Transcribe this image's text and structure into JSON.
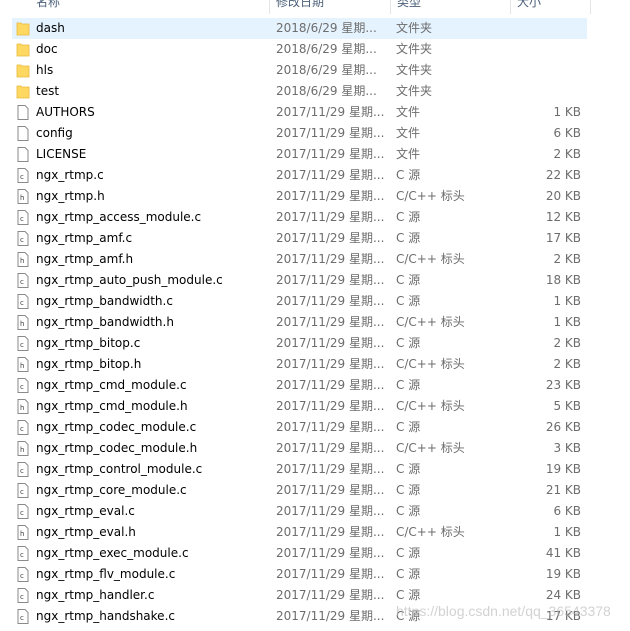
{
  "header": {
    "columns": [
      "名称",
      "修改日期",
      "类型",
      "大小"
    ]
  },
  "colors": {
    "selected_row": "#e5f3ff",
    "folder": "#ffd862"
  },
  "files": [
    {
      "name": "dash",
      "date": "2018/6/29 星期...",
      "type": "文件夹",
      "size": "",
      "icon": "folder-icon",
      "selected": true
    },
    {
      "name": "doc",
      "date": "2018/6/29 星期...",
      "type": "文件夹",
      "size": "",
      "icon": "folder-icon"
    },
    {
      "name": "hls",
      "date": "2018/6/29 星期...",
      "type": "文件夹",
      "size": "",
      "icon": "folder-icon"
    },
    {
      "name": "test",
      "date": "2018/6/29 星期...",
      "type": "文件夹",
      "size": "",
      "icon": "folder-icon"
    },
    {
      "name": "AUTHORS",
      "date": "2017/11/29 星期...",
      "type": "文件",
      "size": "1 KB",
      "icon": "file-icon"
    },
    {
      "name": "config",
      "date": "2017/11/29 星期...",
      "type": "文件",
      "size": "6 KB",
      "icon": "file-icon"
    },
    {
      "name": "LICENSE",
      "date": "2017/11/29 星期...",
      "type": "文件",
      "size": "2 KB",
      "icon": "file-icon"
    },
    {
      "name": "ngx_rtmp.c",
      "date": "2017/11/29 星期...",
      "type": "C 源",
      "size": "22 KB",
      "icon": "c-file-icon"
    },
    {
      "name": "ngx_rtmp.h",
      "date": "2017/11/29 星期...",
      "type": "C/C++ 标头",
      "size": "20 KB",
      "icon": "h-file-icon"
    },
    {
      "name": "ngx_rtmp_access_module.c",
      "date": "2017/11/29 星期...",
      "type": "C 源",
      "size": "12 KB",
      "icon": "c-file-icon"
    },
    {
      "name": "ngx_rtmp_amf.c",
      "date": "2017/11/29 星期...",
      "type": "C 源",
      "size": "17 KB",
      "icon": "c-file-icon"
    },
    {
      "name": "ngx_rtmp_amf.h",
      "date": "2017/11/29 星期...",
      "type": "C/C++ 标头",
      "size": "2 KB",
      "icon": "h-file-icon"
    },
    {
      "name": "ngx_rtmp_auto_push_module.c",
      "date": "2017/11/29 星期...",
      "type": "C 源",
      "size": "18 KB",
      "icon": "c-file-icon"
    },
    {
      "name": "ngx_rtmp_bandwidth.c",
      "date": "2017/11/29 星期...",
      "type": "C 源",
      "size": "1 KB",
      "icon": "c-file-icon"
    },
    {
      "name": "ngx_rtmp_bandwidth.h",
      "date": "2017/11/29 星期...",
      "type": "C/C++ 标头",
      "size": "1 KB",
      "icon": "h-file-icon"
    },
    {
      "name": "ngx_rtmp_bitop.c",
      "date": "2017/11/29 星期...",
      "type": "C 源",
      "size": "2 KB",
      "icon": "c-file-icon"
    },
    {
      "name": "ngx_rtmp_bitop.h",
      "date": "2017/11/29 星期...",
      "type": "C/C++ 标头",
      "size": "2 KB",
      "icon": "h-file-icon"
    },
    {
      "name": "ngx_rtmp_cmd_module.c",
      "date": "2017/11/29 星期...",
      "type": "C 源",
      "size": "23 KB",
      "icon": "c-file-icon"
    },
    {
      "name": "ngx_rtmp_cmd_module.h",
      "date": "2017/11/29 星期...",
      "type": "C/C++ 标头",
      "size": "5 KB",
      "icon": "h-file-icon"
    },
    {
      "name": "ngx_rtmp_codec_module.c",
      "date": "2017/11/29 星期...",
      "type": "C 源",
      "size": "26 KB",
      "icon": "c-file-icon"
    },
    {
      "name": "ngx_rtmp_codec_module.h",
      "date": "2017/11/29 星期...",
      "type": "C/C++ 标头",
      "size": "3 KB",
      "icon": "h-file-icon"
    },
    {
      "name": "ngx_rtmp_control_module.c",
      "date": "2017/11/29 星期...",
      "type": "C 源",
      "size": "19 KB",
      "icon": "c-file-icon"
    },
    {
      "name": "ngx_rtmp_core_module.c",
      "date": "2017/11/29 星期...",
      "type": "C 源",
      "size": "21 KB",
      "icon": "c-file-icon"
    },
    {
      "name": "ngx_rtmp_eval.c",
      "date": "2017/11/29 星期...",
      "type": "C 源",
      "size": "6 KB",
      "icon": "c-file-icon"
    },
    {
      "name": "ngx_rtmp_eval.h",
      "date": "2017/11/29 星期...",
      "type": "C/C++ 标头",
      "size": "1 KB",
      "icon": "h-file-icon"
    },
    {
      "name": "ngx_rtmp_exec_module.c",
      "date": "2017/11/29 星期...",
      "type": "C 源",
      "size": "41 KB",
      "icon": "c-file-icon"
    },
    {
      "name": "ngx_rtmp_flv_module.c",
      "date": "2017/11/29 星期...",
      "type": "C 源",
      "size": "19 KB",
      "icon": "c-file-icon"
    },
    {
      "name": "ngx_rtmp_handler.c",
      "date": "2017/11/29 星期...",
      "type": "C 源",
      "size": "24 KB",
      "icon": "c-file-icon"
    },
    {
      "name": "ngx_rtmp_handshake.c",
      "date": "2017/11/29 星期...",
      "type": "C 源",
      "size": "17 KB",
      "icon": "c-file-icon"
    }
  ],
  "watermark": "https://blog.csdn.net/qq_36543378"
}
